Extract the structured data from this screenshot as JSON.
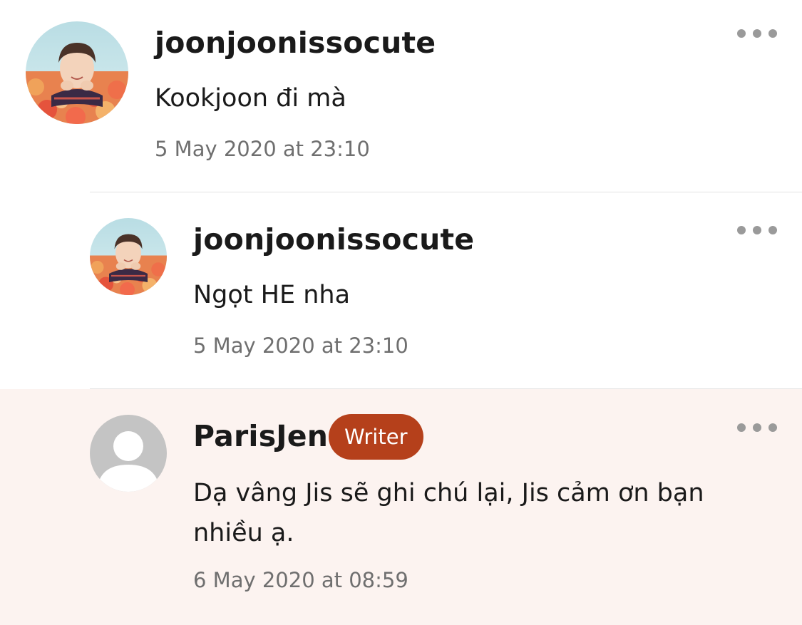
{
  "comments": [
    {
      "username": "joonjoonissocute",
      "text": "Kookjoon đi mà",
      "timestamp": "5 May 2020 at 23:10",
      "avatar": "user-photo-avatar"
    },
    {
      "username": "joonjoonissocute",
      "text": "Ngọt HE nha",
      "timestamp": "5 May 2020 at 23:10",
      "avatar": "user-photo-avatar"
    },
    {
      "username": "ParisJen",
      "badge": "Writer",
      "text": "Dạ vâng Jis sẽ ghi chú lại, Jis cảm ơn bạn nhiều ạ.",
      "timestamp": "6 May 2020 at 08:59",
      "avatar": "default-person-avatar",
      "highlight_color": "#fcf3f0"
    }
  ],
  "colors": {
    "badge": "#b5401b",
    "timestamp": "#6f6f6f",
    "more_dots": "#9a9a9a",
    "divider": "#e3e3e3"
  },
  "icons": {
    "more": "more-horizontal-icon"
  }
}
